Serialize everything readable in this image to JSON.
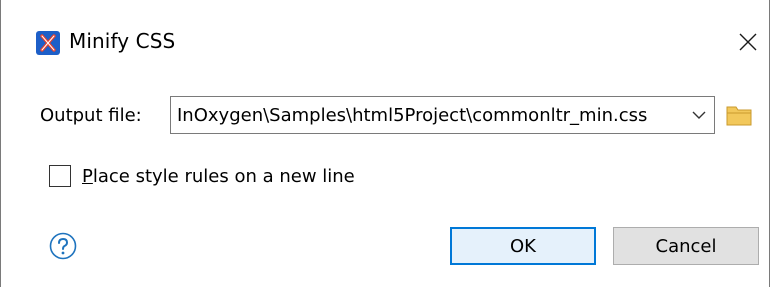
{
  "window": {
    "title": "Minify CSS",
    "app_icon": "oxygen-x-icon",
    "close_icon": "close-icon"
  },
  "form": {
    "output_label": "Output file:",
    "output_value": "InOxygen\\Samples\\html5Project\\commonltr_min.css",
    "dropdown_icon": "chevron-down-icon",
    "browse_icon": "folder-icon",
    "checkbox_label_mnemonic": "P",
    "checkbox_label_rest": "lace style rules on a new line",
    "checkbox_checked": false
  },
  "footer": {
    "help_icon": "help-icon",
    "ok_label": "OK",
    "cancel_label": "Cancel"
  },
  "colors": {
    "app_icon_bg": "#1d5fc8",
    "app_icon_x": "#e8412c",
    "folder": "#f2c85b",
    "default_button_border": "#0078d7",
    "default_button_bg": "#e5f1fb",
    "help_blue": "#1e73be"
  }
}
